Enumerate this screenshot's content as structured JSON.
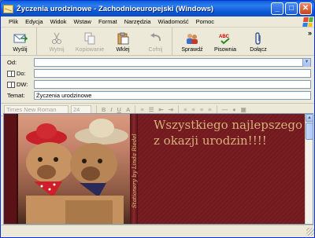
{
  "window": {
    "title": "Życzenia urodzinowe - Zachodnioeuropejski (Windows)",
    "controls": {
      "minimize": "_",
      "maximize": "□",
      "close": "✕"
    }
  },
  "menu": [
    "Plik",
    "Edycja",
    "Widok",
    "Wstaw",
    "Format",
    "Narzędzia",
    "Wiadomość",
    "Pomoc"
  ],
  "toolbar": {
    "send": "Wyślij",
    "cut": "Wytnij",
    "copy": "Kopiowanie",
    "paste": "Wklej",
    "undo": "Cofnij",
    "check": "Sprawdź",
    "spelling": "Pisownia",
    "attach": "Dołącz",
    "spelling_icon_text": "ABC",
    "overflow": "»"
  },
  "header": {
    "from_label": "Od:",
    "from_value": "",
    "to_label": "Do:",
    "to_value": "",
    "cc_label": "DW:",
    "cc_value": "",
    "subject_label": "Temat:",
    "subject_value": "Życzenia urodzinowe"
  },
  "format_bar": {
    "font": "Times New Roman",
    "size": "24",
    "bold": "B",
    "italic": "I",
    "underline": "U",
    "color": "A"
  },
  "message": {
    "greeting_line1": "Wszystkiego najlepszego",
    "greeting_line2": "z okazji urodzin!!!!",
    "signature": "Stationery by Linda Riedel"
  },
  "colors": {
    "titlebar": "#0a5fd8",
    "stationery_bg": "#7a1e23",
    "greeting_text": "#d8b07a"
  }
}
